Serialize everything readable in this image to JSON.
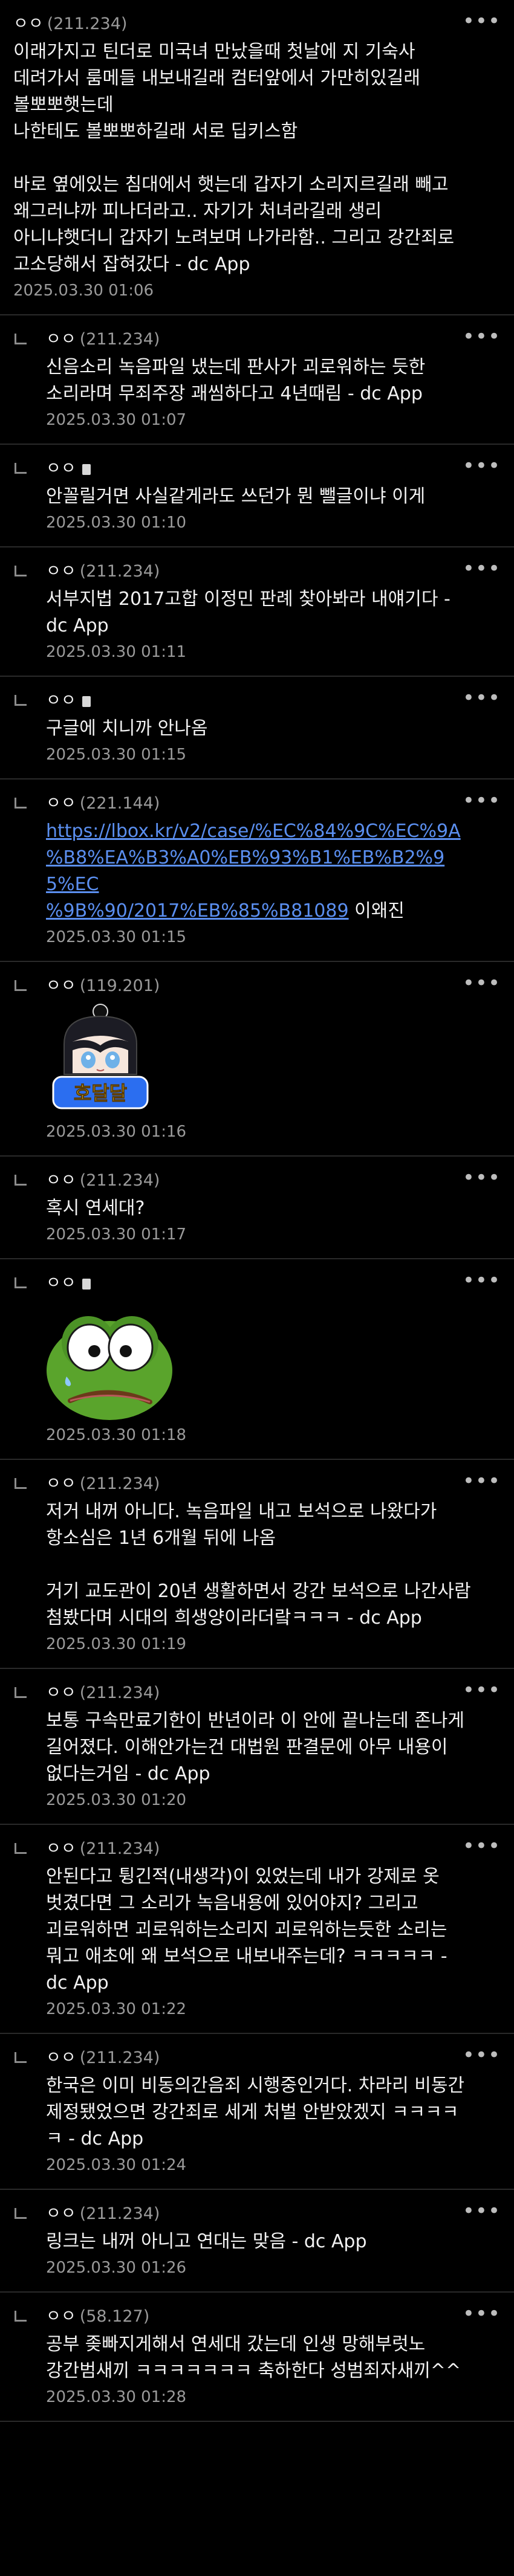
{
  "comments": [
    {
      "reply": false,
      "nick": "ㅇㅇ",
      "ip": "(211.234)",
      "mobile": false,
      "text": "이래가지고 틴더로 미국녀 만났을때 첫날에 지 기숙사\n데려가서 룸메들 내보내길래 컴터앞에서 가만히있길래\n볼뽀뽀햇는데\n나한테도 볼뽀뽀하길래 서로 딥키스함\n\n바로 옆에있는 침대에서 햇는데 갑자기 소리지르길래 빼고\n왜그러냐까 피나더라고.. 자기가 처녀라길래 생리\n아니냐햇더니 갑자기 노려보며 나가라함.. 그리고 강간죄로\n고소당해서 잡혀갔다 - dc App",
      "date": "2025.03.30 01:06"
    },
    {
      "reply": true,
      "nick": "ㅇㅇ",
      "ip": "(211.234)",
      "mobile": false,
      "text": "신음소리 녹음파일 냈는데 판사가 괴로워하는 듯한\n소리라며 무죄주장 괘씸하다고 4년때림 - dc App",
      "date": "2025.03.30 01:07"
    },
    {
      "reply": true,
      "nick": "ㅇㅇ",
      "ip": "",
      "mobile": true,
      "text": "안꼴릴거면 사실같게라도 쓰던가 뭔 뺄글이냐 이게",
      "date": "2025.03.30 01:10"
    },
    {
      "reply": true,
      "nick": "ㅇㅇ",
      "ip": "(211.234)",
      "mobile": false,
      "text": "서부지법 2017고합 이정민 판례 찾아봐라 내얘기다 -\ndc App",
      "date": "2025.03.30 01:11"
    },
    {
      "reply": true,
      "nick": "ㅇㅇ",
      "ip": "",
      "mobile": true,
      "text": "구글에 치니까 안나옴",
      "date": "2025.03.30 01:15"
    },
    {
      "reply": true,
      "nick": "ㅇㅇ",
      "ip": "(221.144)",
      "mobile": false,
      "link": "https://lbox.kr/v2/case/%EC%84%9C%EC%9A%B8%EA%B3%A0%EB%93%B1%EB%B2%95%EC%9B%90/2017%EB%85%B81089",
      "link_lines": [
        "https://lbox.kr/v2/case/%EC%84%9C%EC%9A",
        "%B8%EA%B3%A0%EB%93%B1%EB%B2%95%EC",
        "%9B%90/2017%EB%85%B81089"
      ],
      "text": " 이왜진",
      "date": "2025.03.30 01:15"
    },
    {
      "reply": true,
      "nick": "ㅇㅇ",
      "ip": "(119.201)",
      "mobile": false,
      "sticker": "dalgona",
      "sticker_text": "호달달",
      "text": "",
      "date": "2025.03.30 01:16"
    },
    {
      "reply": true,
      "nick": "ㅇㅇ",
      "ip": "(211.234)",
      "mobile": false,
      "text": "혹시 연세대?",
      "date": "2025.03.30 01:17"
    },
    {
      "reply": true,
      "nick": "ㅇㅇ",
      "ip": "",
      "mobile": true,
      "sticker": "pepe",
      "text": "",
      "date": "2025.03.30 01:18"
    },
    {
      "reply": true,
      "nick": "ㅇㅇ",
      "ip": "(211.234)",
      "mobile": false,
      "text": "저거 내꺼 아니다. 녹음파일 내고 보석으로 나왔다가\n항소심은 1년 6개월 뒤에 나옴\n\n거기 교도관이 20년 생활하면서 강간 보석으로 나간사람\n첨봤다며 시대의 희생양이라더랔ㅋㅋㅋ - dc App",
      "date": "2025.03.30 01:19"
    },
    {
      "reply": true,
      "nick": "ㅇㅇ",
      "ip": "(211.234)",
      "mobile": false,
      "text": "보통 구속만료기한이 반년이라 이 안에 끝나는데 존나게\n길어졌다. 이해안가는건 대법원 판결문에 아무 내용이\n없다는거임 - dc App",
      "date": "2025.03.30 01:20"
    },
    {
      "reply": true,
      "nick": "ㅇㅇ",
      "ip": "(211.234)",
      "mobile": false,
      "text": "안된다고 튕긴적(내생각)이 있었는데 내가 강제로 옷\n벗겼다면 그 소리가 녹음내용에 있어야지? 그리고\n괴로워하면 괴로워하는소리지 괴로워하는듯한 소리는\n뭐고 애초에 왜 보석으로 내보내주는데? ㅋㅋㅋㅋㅋ -\ndc App",
      "date": "2025.03.30 01:22"
    },
    {
      "reply": true,
      "nick": "ㅇㅇ",
      "ip": "(211.234)",
      "mobile": false,
      "text": "한국은 이미 비동의간음죄 시행중인거다. 차라리 비동간\n제정됐었으면 강간죄로 세게 처벌 안받았겠지 ㅋㅋㅋㅋ\nㅋ - dc App",
      "date": "2025.03.30 01:24"
    },
    {
      "reply": true,
      "nick": "ㅇㅇ",
      "ip": "(211.234)",
      "mobile": false,
      "text": "링크는 내꺼 아니고 연대는 맞음 - dc App",
      "date": "2025.03.30 01:26"
    },
    {
      "reply": true,
      "nick": "ㅇㅇ",
      "ip": "(58.127)",
      "mobile": false,
      "text": "공부 좆빠지게해서 연세대 갔는데 인생 망해부럿노\n강간범새끼 ㅋㅋㅋㅋㅋㅋㅋ 축하한다 성범죄자새끼^^",
      "date": "2025.03.30 01:28"
    }
  ],
  "more_label": "•••",
  "colors": {
    "background": "#000000",
    "divider": "#2a2a2a",
    "link": "#5b8ff0",
    "meta": "#9a9a9a"
  }
}
